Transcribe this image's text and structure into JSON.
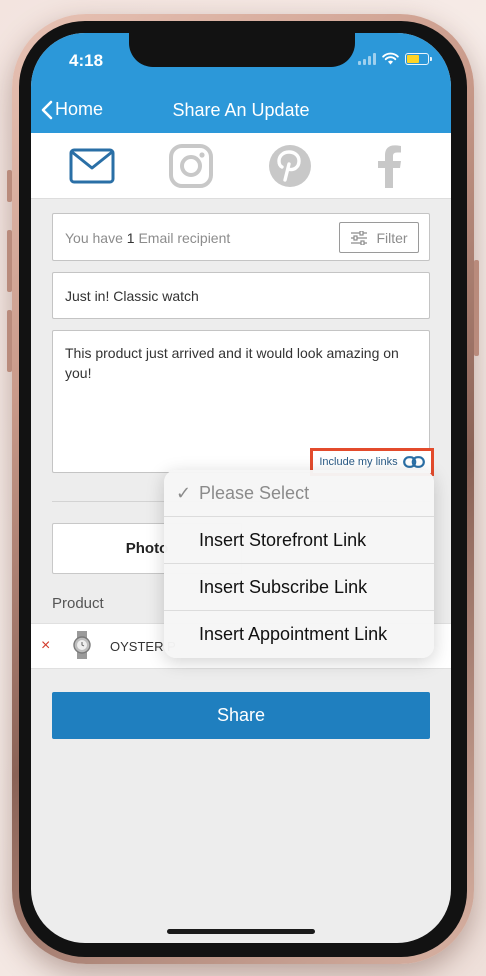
{
  "status": {
    "time": "4:18"
  },
  "nav": {
    "back_label": "Home",
    "title": "Share An Update"
  },
  "tabs": [
    {
      "name": "email",
      "icon": "envelope-icon",
      "active": true
    },
    {
      "name": "instagram",
      "icon": "instagram-icon",
      "active": false
    },
    {
      "name": "pinterest",
      "icon": "pinterest-icon",
      "active": false
    },
    {
      "name": "facebook",
      "icon": "facebook-icon",
      "active": false
    }
  ],
  "recipients": {
    "prefix": "You have",
    "count": "1",
    "suffix": "Email recipient",
    "filter_label": "Filter"
  },
  "subject": {
    "value": "Just in! Classic watch"
  },
  "message": {
    "value": "This product just arrived and it would look amazing on you!"
  },
  "include_links": {
    "label": "Include my links"
  },
  "photo_button": {
    "label": "Photo"
  },
  "product": {
    "section_label": "Product",
    "name": "OYSTER P",
    "remove_symbol": "×"
  },
  "share_button": {
    "label": "Share"
  },
  "dropdown": {
    "options": [
      {
        "label": "Please Select",
        "selected": true
      },
      {
        "label": "Insert Storefront Link",
        "selected": false
      },
      {
        "label": "Insert Subscribe Link",
        "selected": false
      },
      {
        "label": "Insert Appointment Link",
        "selected": false
      }
    ]
  },
  "colors": {
    "brand_blue": "#2c98d9",
    "share_blue": "#1f7fbf",
    "highlight_red": "#e34b2c",
    "active_icon": "#2a6fa6",
    "inactive_icon": "#c8c8c8"
  }
}
